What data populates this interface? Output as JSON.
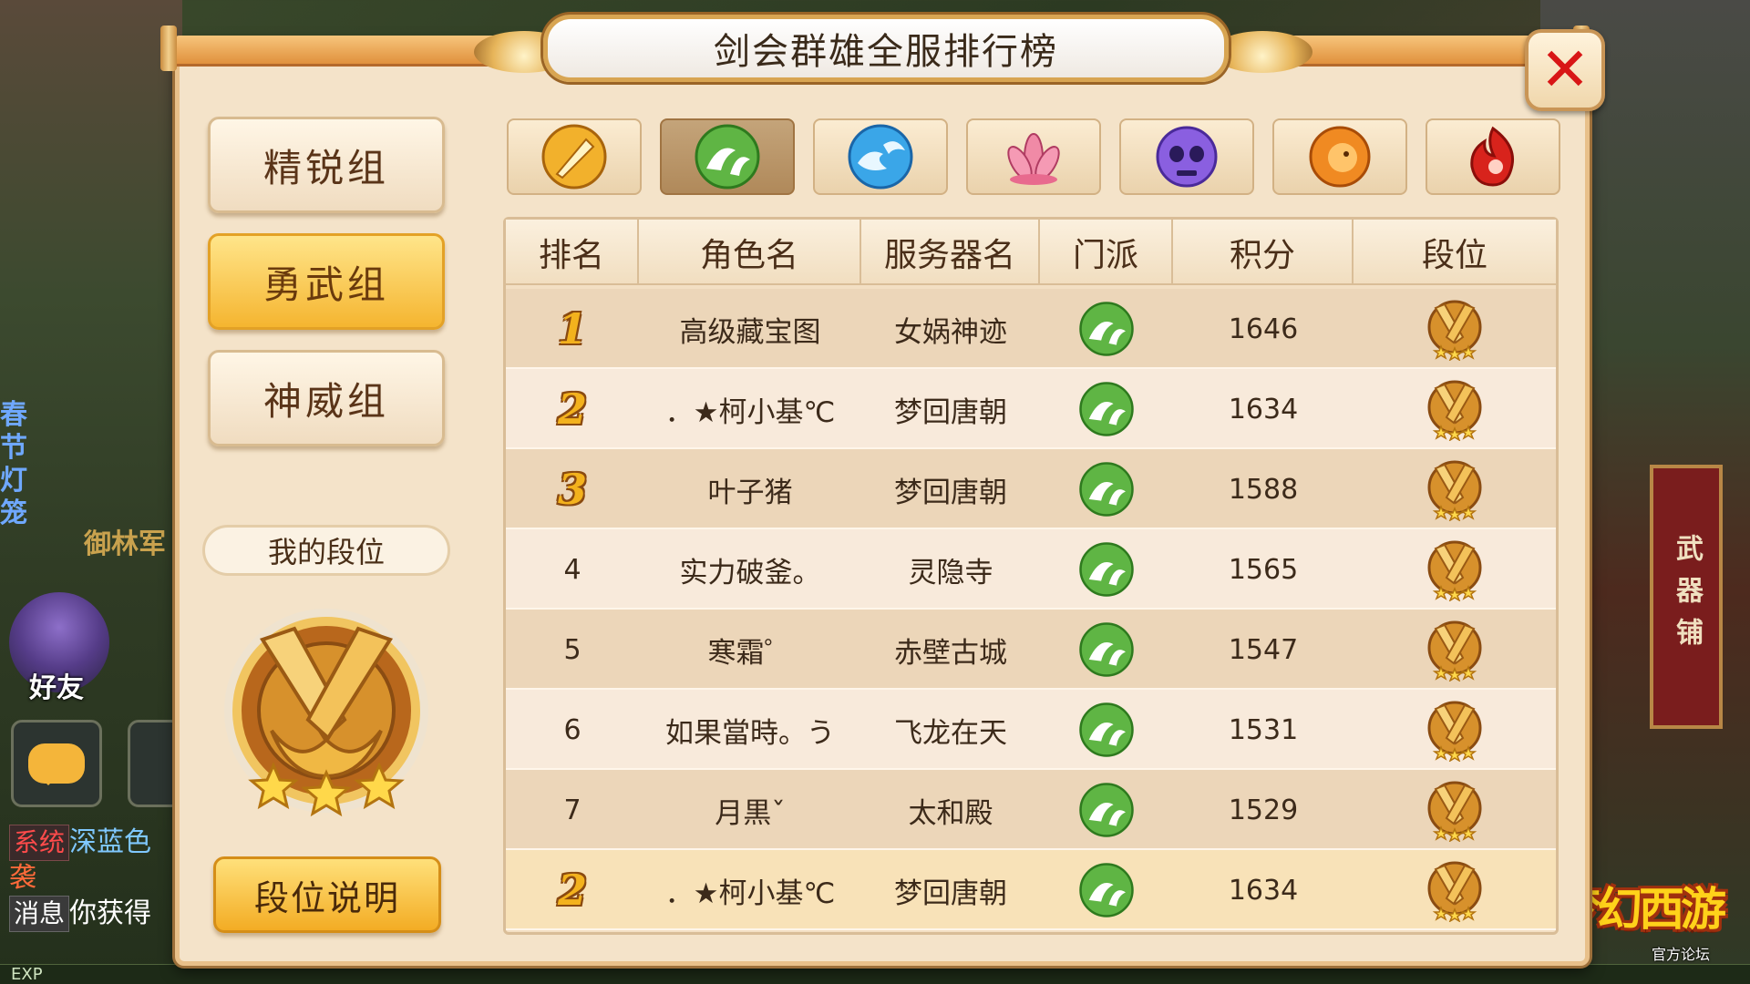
{
  "title": "剑会群雄全服排行榜",
  "close_label": "✕",
  "groups": [
    {
      "label": "精锐组",
      "active": false
    },
    {
      "label": "勇武组",
      "active": true
    },
    {
      "label": "神威组",
      "active": false
    }
  ],
  "my_rank_label": "我的段位",
  "my_rank_stars": 3,
  "rule_button": "段位说明",
  "school_tabs": [
    {
      "icon": "sword-school-icon",
      "color": "#f2b12c",
      "active": false
    },
    {
      "icon": "leaf-school-icon",
      "color": "#5fb544",
      "active": true
    },
    {
      "icon": "water-school-icon",
      "color": "#3aa6e8",
      "active": false
    },
    {
      "icon": "lotus-school-icon",
      "color": "#e86a8e",
      "active": false
    },
    {
      "icon": "skull-school-icon",
      "color": "#8a5fe0",
      "active": false
    },
    {
      "icon": "lion-school-icon",
      "color": "#f08a22",
      "active": false
    },
    {
      "icon": "flame-school-icon",
      "color": "#d8231c",
      "active": false
    }
  ],
  "table": {
    "headers": [
      "排名",
      "角色名",
      "服务器名",
      "门派",
      "积分",
      "段位"
    ],
    "rows": [
      {
        "rank": "1",
        "name": "高级藏宝图",
        "server": "女娲神迹",
        "score": "1646"
      },
      {
        "rank": "2",
        "name": "．★柯小基℃",
        "server": "梦回唐朝",
        "score": "1634"
      },
      {
        "rank": "3",
        "name": "叶子猪",
        "server": "梦回唐朝",
        "score": "1588"
      },
      {
        "rank": "4",
        "name": "实力破釜。",
        "server": "灵隐寺",
        "score": "1565"
      },
      {
        "rank": "5",
        "name": "寒霜゜",
        "server": "赤壁古城",
        "score": "1547"
      },
      {
        "rank": "6",
        "name": "如果當時。う",
        "server": "飞龙在天",
        "score": "1531"
      },
      {
        "rank": "7",
        "name": "月黒ˇ",
        "server": "太和殿",
        "score": "1529"
      }
    ],
    "mine": {
      "rank": "2",
      "name": "．★柯小基℃",
      "server": "梦回唐朝",
      "score": "1634"
    }
  },
  "background": {
    "festival_text": "春节灯笼",
    "guard_text": "御林军",
    "friend_label": "好友",
    "chat": [
      {
        "tag": "系统",
        "text": "深蓝色"
      },
      {
        "tag": "",
        "text": "袭"
      },
      {
        "tag": "消息",
        "text": "你获得"
      }
    ],
    "exp_label": "EXP",
    "sign_text": "武器铺",
    "logo_text": "梦幻西游",
    "logo_sub": "官方论坛"
  }
}
